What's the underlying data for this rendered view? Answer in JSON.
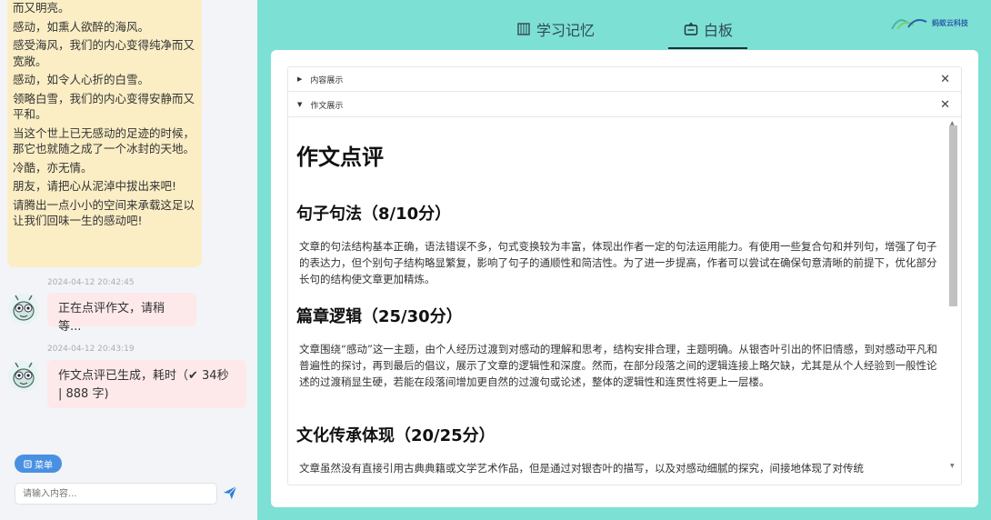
{
  "chat": {
    "essay_lines": [
      "而又明亮。",
      " 感动，如熏人欲醉的海风。",
      "感受海风，我们的内心变得纯净而又宽敞。",
      " 感动，如令人心折的白雪。",
      "领略白雪，我们的内心变得安静而又平和。",
      " 当这个世上已无感动的足迹的时候，那它也就随之成了一个冰封的天地。",
      " 冷酷，亦无情。",
      " 朋友，请把心从泥淖中拔出来吧!",
      "请腾出一点小小的空间来承载这足以让我们回味一生的感动吧!"
    ],
    "messages": [
      {
        "timestamp": "2024-04-12 20:42:45",
        "text": "正在点评作文，请稍等..."
      },
      {
        "timestamp": "2024-04-12 20:43:19",
        "text": "作文点评已生成，耗时（✔ 34秒 | 888 字)"
      }
    ],
    "menu_label": "菜单",
    "input_placeholder": "请输入内容..."
  },
  "tabs": [
    {
      "label": "学习记忆",
      "icon": "book-icon"
    },
    {
      "label": "白板",
      "icon": "whiteboard-icon",
      "active": true
    }
  ],
  "logo_text": "蚂蚁云科技",
  "whiteboard": {
    "sections": [
      {
        "label": "内容展示",
        "expanded": false
      },
      {
        "label": "作文展示",
        "expanded": true
      }
    ],
    "article": {
      "title": "作文点评",
      "parts": [
        {
          "heading": "句子句法（8/10分）",
          "text": "文章的句法结构基本正确，语法错误不多，句式变换较为丰富，体现出作者一定的句法运用能力。有使用一些复合句和并列句，增强了句子的表达力，但个别句子结构略显繁复，影响了句子的通顺性和简洁性。为了进一步提高，作者可以尝试在确保句意清晰的前提下，优化部分长句的结构使文章更加精炼。"
        },
        {
          "heading": "篇章逻辑（25/30分）",
          "text": "文章围绕“感动”这一主题，由个人经历过渡到对感动的理解和思考，结构安排合理，主题明确。从银杏叶引出的怀旧情感，到对感动平凡和普遍性的探讨，再到最后的倡议，展示了文章的逻辑性和深度。然而，在部分段落之间的逻辑连接上略欠缺，尤其是从个人经验到一般性论述的过渡稍显生硬，若能在段落间增加更自然的过渡句或论述，整体的逻辑性和连贯性将更上一层楼。"
        },
        {
          "heading": "文化传承体现（20/25分）",
          "text": "文章虽然没有直接引用古典典籍或文学艺术作品，但是通过对银杏叶的描写，以及对感动细腻的探究，间接地体现了对传统"
        }
      ]
    }
  },
  "colors": {
    "right_bg": "#7de0d4",
    "essay_bubble": "#fbeec5",
    "status_bubble": "#fde9ea",
    "menu_button": "#4a90e2",
    "send_icon": "#2f7fd8"
  }
}
